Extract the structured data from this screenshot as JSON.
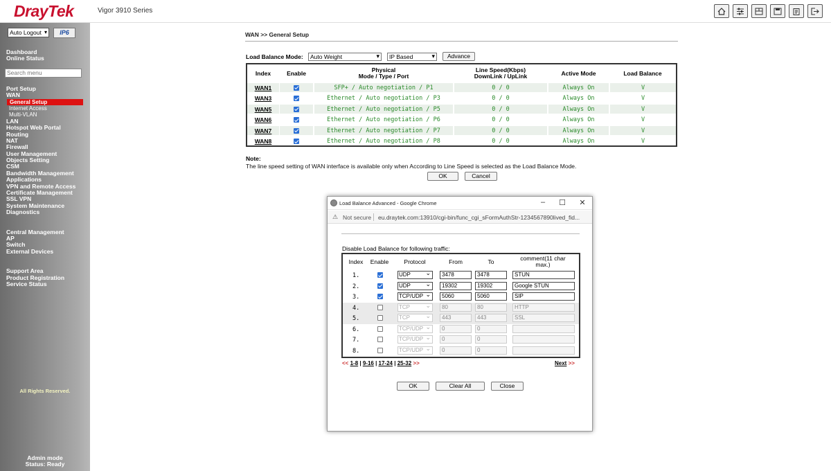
{
  "header": {
    "logo": "DrayTek",
    "model": "Vigor 3910 Series",
    "icons": [
      "home-icon",
      "settings-sliders-icon",
      "dashboard-icon",
      "save-icon",
      "clipboard-icon",
      "logout-icon"
    ]
  },
  "sidebar": {
    "logout_select": "Auto Logout",
    "ip6_badge": "IP6",
    "search_placeholder": "Search menu",
    "top_items": [
      "Dashboard",
      "Online Status"
    ],
    "items": [
      "Port Setup",
      "WAN"
    ],
    "wan_sub": [
      "General Setup",
      "Internet Access",
      "Multi-VLAN"
    ],
    "items2": [
      "LAN",
      "Hotspot Web Portal",
      "Routing",
      "NAT",
      "Firewall",
      "User Management",
      "Objects Setting",
      "CSM",
      "Bandwidth Management",
      "Applications",
      "VPN and Remote Access",
      "Certificate Management",
      "SSL VPN",
      "System Maintenance",
      "Diagnostics"
    ],
    "central": [
      "Central Management",
      "AP",
      "Switch",
      "External Devices"
    ],
    "support": [
      "Support Area",
      "Product Registration",
      "Service Status"
    ],
    "rights": "All Rights Reserved.",
    "admin_mode": "Admin mode",
    "status": "Status: Ready"
  },
  "main": {
    "breadcrumb": "WAN >> General Setup",
    "lb_mode_label": "Load Balance Mode:",
    "lb_mode_value": "Auto Weight",
    "lb_based_value": "IP Based",
    "advance_label": "Advance",
    "table_headers": {
      "index": "Index",
      "enable": "Enable",
      "physical_1": "Physical",
      "physical_2": "Mode / Type / Port",
      "speed_1": "Line Speed(Kbps)",
      "speed_2": "DownLink / UpLink",
      "active": "Active Mode",
      "lb": "Load Balance"
    },
    "rows": [
      {
        "index": "WAN1",
        "mode": "SFP+ / Auto negotiation / P1",
        "speed": "0 / 0",
        "active": "Always On",
        "lb": "V"
      },
      {
        "index": "WAN3",
        "mode": "Ethernet / Auto negotiation / P3",
        "speed": "0 / 0",
        "active": "Always On",
        "lb": "V"
      },
      {
        "index": "WAN5",
        "mode": "Ethernet / Auto negotiation / P5",
        "speed": "0 / 0",
        "active": "Always On",
        "lb": "V"
      },
      {
        "index": "WAN6",
        "mode": "Ethernet / Auto negotiation / P6",
        "speed": "0 / 0",
        "active": "Always On",
        "lb": "V"
      },
      {
        "index": "WAN7",
        "mode": "Ethernet / Auto negotiation / P7",
        "speed": "0 / 0",
        "active": "Always On",
        "lb": "V"
      },
      {
        "index": "WAN8",
        "mode": "Ethernet / Auto negotiation / P8",
        "speed": "0 / 0",
        "active": "Always On",
        "lb": "V"
      }
    ],
    "note_title": "Note:",
    "note_text": "The line speed setting of WAN interface is available only when According to Line Speed is selected as the Load Balance Mode.",
    "ok_label": "OK",
    "cancel_label": "Cancel"
  },
  "popup": {
    "title": "Load Balance Advanced - Google Chrome",
    "not_secure": "Not secure",
    "url": "eu.draytek.com:13910/cgi-bin/func_cgi_sFormAuthStr-1234567890lived_fid...",
    "caption": "Disable Load Balance for following traffic:",
    "headers": {
      "index": "Index",
      "enable": "Enable",
      "protocol": "Protocol",
      "from": "From",
      "to": "To",
      "comment_1": "comment(11 char",
      "comment_2": "max.)"
    },
    "rows": [
      {
        "index": "1.",
        "enabled": true,
        "protocol": "UDP",
        "from": "3478",
        "to": "3478",
        "comment": "STUN"
      },
      {
        "index": "2.",
        "enabled": true,
        "protocol": "UDP",
        "from": "19302",
        "to": "19302",
        "comment": "Google STUN"
      },
      {
        "index": "3.",
        "enabled": true,
        "protocol": "TCP/UDP",
        "from": "5060",
        "to": "5060",
        "comment": "SIP"
      },
      {
        "index": "4.",
        "enabled": false,
        "protocol": "TCP",
        "from": "80",
        "to": "80",
        "comment": "HTTP"
      },
      {
        "index": "5.",
        "enabled": false,
        "protocol": "TCP",
        "from": "443",
        "to": "443",
        "comment": "SSL"
      },
      {
        "index": "6.",
        "enabled": false,
        "protocol": "TCP/UDP",
        "from": "0",
        "to": "0",
        "comment": ""
      },
      {
        "index": "7.",
        "enabled": false,
        "protocol": "TCP/UDP",
        "from": "0",
        "to": "0",
        "comment": ""
      },
      {
        "index": "8.",
        "enabled": false,
        "protocol": "TCP/UDP",
        "from": "0",
        "to": "0",
        "comment": ""
      }
    ],
    "pager": {
      "prev": "<<",
      "pages": [
        "1-8",
        "9-16",
        "17-24",
        "25-32"
      ],
      "next_arrow": ">>",
      "next": "Next",
      "next_arrows": ">>"
    },
    "ok_label": "OK",
    "clear_label": "Clear All",
    "close_label": "Close"
  }
}
